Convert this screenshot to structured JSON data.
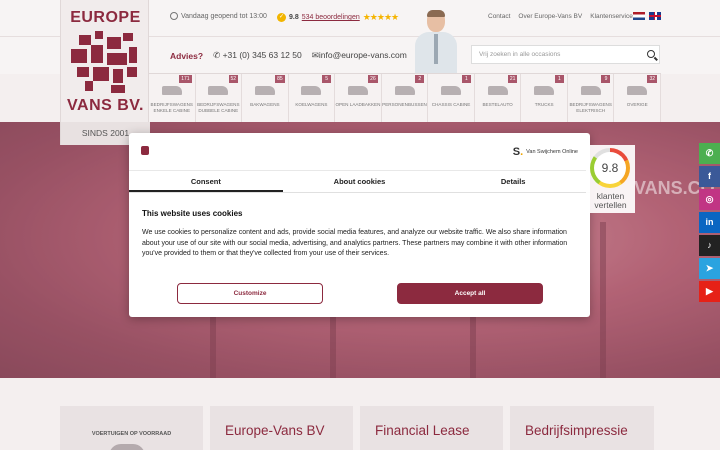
{
  "topbar": {
    "open_text": "Vandaag geopend tot 13:00",
    "rating_score": "9.8",
    "rating_reviews": "534 beoordelingen",
    "links": [
      "Contact",
      "Over Europe-Vans BV",
      "Klantenservice"
    ]
  },
  "logo": {
    "line1": "EUROPE",
    "line2": "VANS BV.",
    "since": "SINDS 2001"
  },
  "contact": {
    "advies_label": "Advies?",
    "phone": "+31 (0) 345 63 12 50",
    "email": "info@europe-vans.com"
  },
  "search": {
    "placeholder": "Vrij zoeken in alle occasions"
  },
  "categories": [
    {
      "label": "Bedrijfswagens enkele cabine",
      "count": "171"
    },
    {
      "label": "Bedrijfswagens dubbele cabine",
      "count": "52"
    },
    {
      "label": "Bakwagens",
      "count": "85"
    },
    {
      "label": "Koelwagens",
      "count": "5"
    },
    {
      "label": "Open laadbakken",
      "count": "26"
    },
    {
      "label": "Personenbussen",
      "count": "2"
    },
    {
      "label": "Chassis cabine",
      "count": "1"
    },
    {
      "label": "Bestelauto",
      "count": "21"
    },
    {
      "label": "Trucks",
      "count": "1"
    },
    {
      "label": "Bedrijfswagens elektrisch",
      "count": "9"
    },
    {
      "label": "Overige",
      "count": "32"
    }
  ],
  "cookie": {
    "provider": "Van Swijchem Online",
    "tabs": [
      "Consent",
      "About cookies",
      "Details"
    ],
    "title": "This website uses cookies",
    "body": "We use cookies to personalize content and ads, provide social media features, and analyze our website traffic. We also share information about your use of our site with our social media, advertising, and analytics partners. These partners may combine it with other information you've provided to them or that they've collected from your use of their services.",
    "customize": "Customize",
    "accept": "Accept all"
  },
  "badge": {
    "score": "9.8",
    "line1": "klanten",
    "line2": "vertellen"
  },
  "hero_text": "VANS.CO",
  "social": [
    {
      "icon": "whatsapp-icon",
      "glyph": "✆",
      "color": "#4caf50"
    },
    {
      "icon": "facebook-icon",
      "glyph": "f",
      "color": "#3b5998"
    },
    {
      "icon": "instagram-icon",
      "glyph": "◎",
      "color": "#c13584"
    },
    {
      "icon": "linkedin-icon",
      "glyph": "in",
      "color": "#0a66c2"
    },
    {
      "icon": "tiktok-icon",
      "glyph": "♪",
      "color": "#222222"
    },
    {
      "icon": "telegram-icon",
      "glyph": "➤",
      "color": "#2aa3e0"
    },
    {
      "icon": "youtube-icon",
      "glyph": "▶",
      "color": "#e62117"
    }
  ],
  "cards": {
    "stock": "VOERTUIGEN OP VOORRAAD",
    "company": "Europe-Vans BV",
    "lease": "Financial Lease",
    "impression": "Bedrijfsimpressie"
  },
  "colors": {
    "brand": "#8c2a3f",
    "accept_button": "#8c2a3f"
  }
}
